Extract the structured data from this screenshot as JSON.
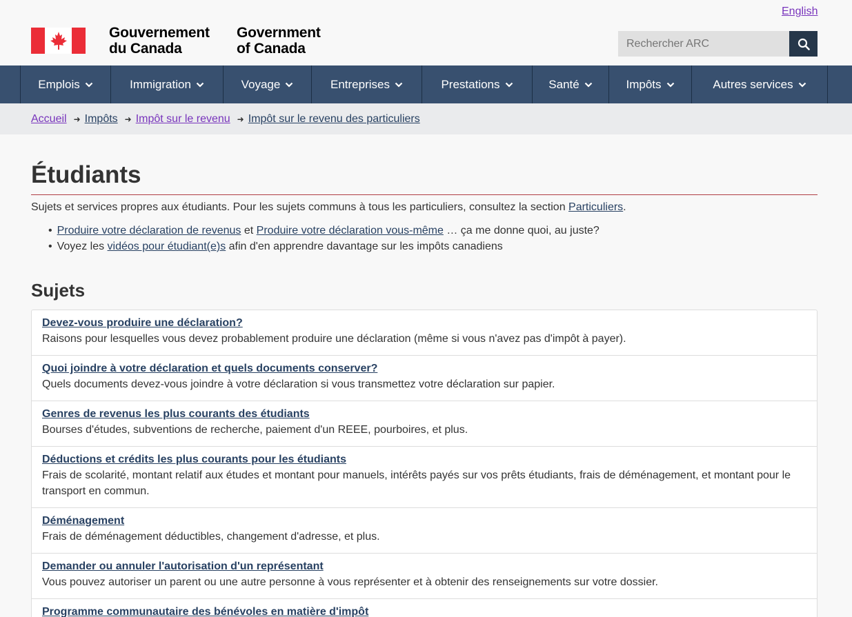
{
  "header": {
    "lang_toggle": "English",
    "signature_fr": "Gouvernement du Canada",
    "signature_fr_line1": "Gouvernement",
    "signature_fr_line2": "du Canada",
    "signature_en_line1": "Government",
    "signature_en_line2": "of Canada",
    "search_placeholder": "Rechercher ARC"
  },
  "menu": [
    {
      "label": "Emplois"
    },
    {
      "label": "Immigration"
    },
    {
      "label": "Voyage"
    },
    {
      "label": "Entreprises"
    },
    {
      "label": "Prestations"
    },
    {
      "label": "Santé"
    },
    {
      "label": "Impôts"
    },
    {
      "label": "Autres services"
    }
  ],
  "breadcrumb": [
    {
      "label": "Accueil"
    },
    {
      "label": "Impôts"
    },
    {
      "label": "Impôt sur le revenu"
    },
    {
      "label": "Impôt sur le revenu des particuliers"
    }
  ],
  "main": {
    "title": "Étudiants",
    "intro_text": "Sujets et services propres aux étudiants. Pour les sujets communs à tous les particuliers, consultez la section ",
    "intro_link": "Particuliers",
    "intro_end": ".",
    "bullet1_link1": "Produire votre déclaration de revenus",
    "bullet1_mid": " et ",
    "bullet1_link2": "Produire votre déclaration vous-même",
    "bullet1_end": " … ça me donne quoi, au juste?",
    "bullet2_start": "Voyez les ",
    "bullet2_link": "vidéos pour étudiant(e)s",
    "bullet2_end": " afin d'en apprendre davantage sur les impôts canadiens",
    "topics_heading": "Sujets",
    "topics": [
      {
        "title": "Devez-vous produire une déclaration?",
        "desc": "Raisons pour lesquelles vous devez probablement produire une déclaration (même si vous n'avez pas d'impôt à payer)."
      },
      {
        "title": "Quoi joindre à votre déclaration et quels documents conserver?",
        "desc": "Quels documents devez-vous joindre à votre déclaration si vous transmettez votre déclaration sur papier."
      },
      {
        "title": "Genres de revenus les plus courants des étudiants",
        "desc": "Bourses d'études, subventions de recherche, paiement d'un REEE, pourboires, et plus."
      },
      {
        "title": "Déductions et crédits les plus courants pour les étudiants",
        "desc": "Frais de scolarité, montant relatif aux études et montant pour manuels, intérêts payés sur vos prêts étudiants, frais de déménagement, et montant pour le transport en commun."
      },
      {
        "title": "Déménagement",
        "desc": "Frais de déménagement déductibles, changement d'adresse, et plus."
      },
      {
        "title": "Demander ou annuler l'autorisation d'un représentant",
        "desc": "Vous pouvez autoriser un parent ou une autre personne à vous représenter et à obtenir des renseignements sur votre dossier."
      },
      {
        "title": "Programme communautaire des bénévoles en matière d'impôt",
        "desc": ""
      }
    ]
  },
  "colors": {
    "menu_bg": "#38506f",
    "link": "#284162",
    "visited_link": "#7834bc",
    "flag_red": "#eb2d37",
    "title_rule": "#af3c43"
  }
}
